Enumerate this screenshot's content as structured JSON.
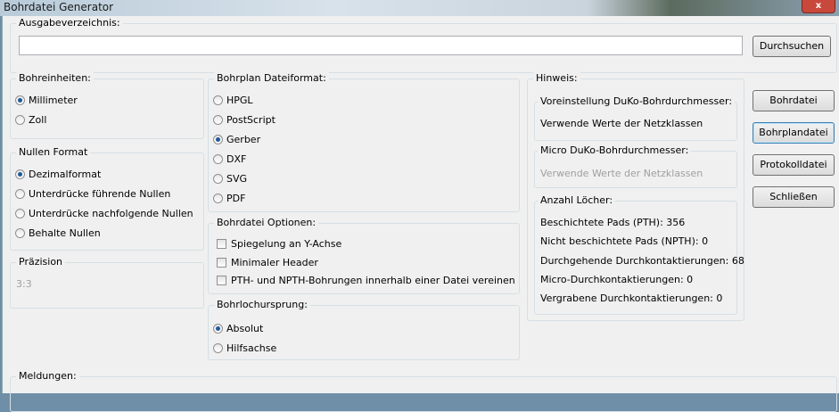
{
  "window": {
    "title": "Bohrdatei Generator",
    "close": "x"
  },
  "output": {
    "label": "Ausgabeverzeichnis:",
    "value": "",
    "browse": "Durchsuchen"
  },
  "units": {
    "label": "Bohreinheiten:",
    "options": [
      "Millimeter",
      "Zoll"
    ],
    "selected": 0
  },
  "zeros": {
    "label": "Nullen Format",
    "options": [
      "Dezimalformat",
      "Unterdrücke führende Nullen",
      "Unterdrücke nachfolgende Nullen",
      "Behalte Nullen"
    ],
    "selected": 0
  },
  "precision": {
    "label": "Präzision",
    "value": "3:3"
  },
  "format": {
    "label": "Bohrplan Dateiformat:",
    "options": [
      "HPGL",
      "PostScript",
      "Gerber",
      "DXF",
      "SVG",
      "PDF"
    ],
    "selected": 2
  },
  "options": {
    "label": "Bohrdatei Optionen:",
    "items": [
      "Spiegelung an Y-Achse",
      "Minimaler Header",
      "PTH- und NPTH-Bohrungen innerhalb einer Datei vereinen"
    ]
  },
  "origin": {
    "label": "Bohrlochursprung:",
    "options": [
      "Absolut",
      "Hilfsachse"
    ],
    "selected": 0
  },
  "hint": {
    "label": "Hinweis:",
    "preset": {
      "label": "Voreinstellung DuKo-Bohrdurchmesser:",
      "value": "Verwende Werte der Netzklassen"
    },
    "micro": {
      "label": "Micro DuKo-Bohrdurchmesser:",
      "value": "Verwende Werte der Netzklassen"
    },
    "holes": {
      "label": "Anzahl Löcher:",
      "items": [
        "Beschichtete Pads (PTH): 356",
        "Nicht beschichtete Pads (NPTH): 0",
        "Durchgehende Durchkontaktierungen: 68",
        "Micro-Durchkontaktierungen: 0",
        "Vergrabene Durchkontaktierungen: 0"
      ]
    }
  },
  "buttons": [
    "Bohrdatei",
    "Bohrplandatei",
    "Protokolldatei",
    "Schließen"
  ],
  "messages": {
    "label": "Meldungen:"
  }
}
